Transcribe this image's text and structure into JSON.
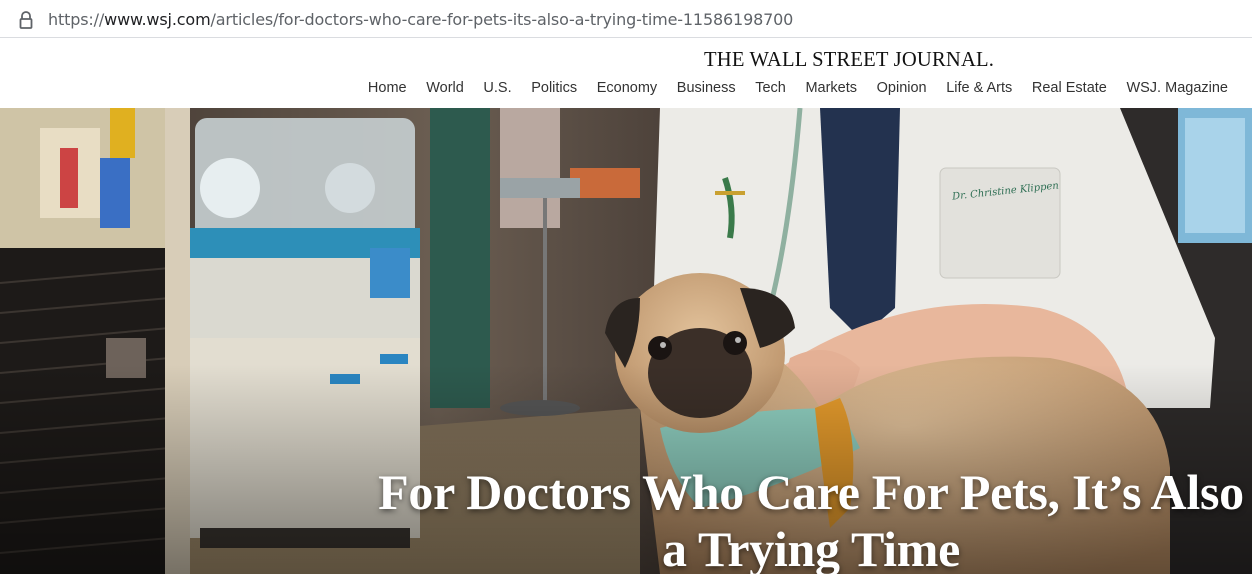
{
  "browser": {
    "url_prefix": "https://",
    "url_domain": "www.wsj.com",
    "url_path": "/articles/for-doctors-who-care-for-pets-its-also-a-trying-time-11586198700"
  },
  "header": {
    "logo_text": "THE WALL STREET JOURNAL.",
    "nav": [
      "Home",
      "World",
      "U.S.",
      "Politics",
      "Economy",
      "Business",
      "Tech",
      "Markets",
      "Opinion",
      "Life & Arts",
      "Real Estate",
      "WSJ. Magazine"
    ]
  },
  "article": {
    "headline": "For Doctors Who Care For Pets, It’s Also a Trying Time",
    "coat_name_tag": "Dr. Christine Klippen"
  },
  "icons": {
    "address_bar": "lock-icon"
  }
}
